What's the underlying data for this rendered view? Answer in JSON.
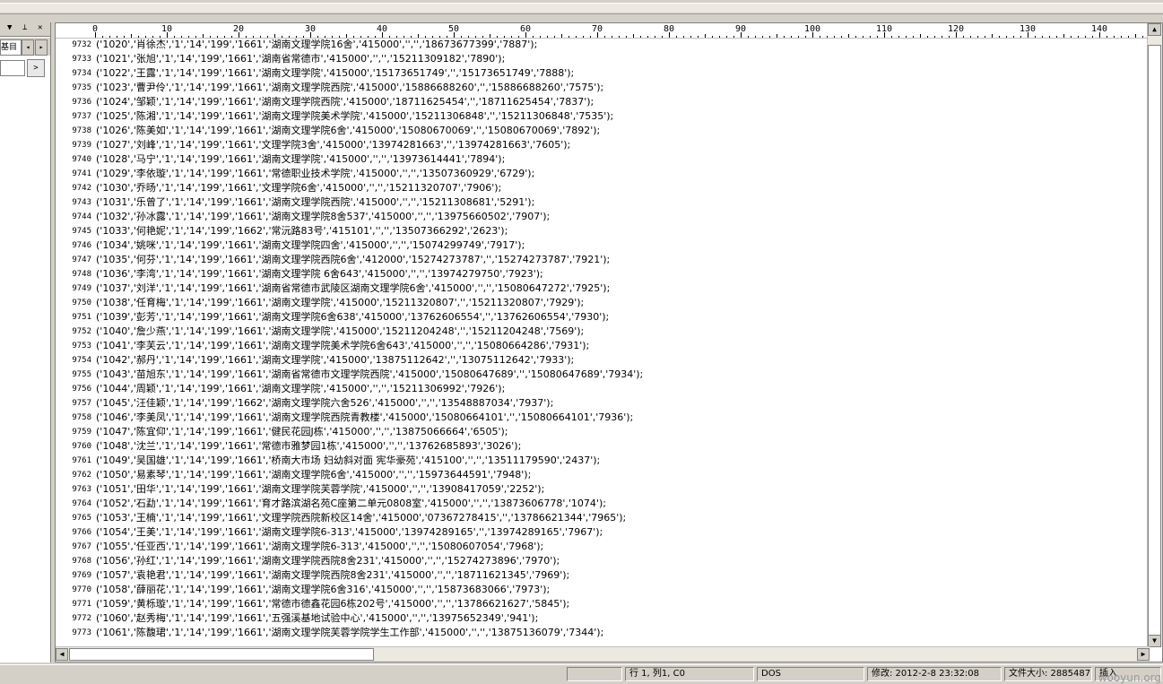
{
  "panel": {
    "tab_label": "基目录",
    "prev_label": "◂",
    "next_label": "▸",
    "go_label": ">"
  },
  "ruler": [
    "0",
    "10",
    "20",
    "30",
    "40",
    "50",
    "60",
    "70",
    "80",
    "90",
    "100",
    "110",
    "120",
    "130",
    "140"
  ],
  "lines": [
    {
      "n": "9732",
      "t": "('1020','肖徐杰','1','14','199','1661','湖南文理学院16舍','415000','','','18673677399','7887');"
    },
    {
      "n": "9733",
      "t": "('1021','张旭','1','14','199','1661','湖南省常德市','415000','','','15211309182','7890');"
    },
    {
      "n": "9734",
      "t": "('1022','王露','1','14','199','1661','湖南文理学院','415000','15173651749','','15173651749','7888');"
    },
    {
      "n": "9735",
      "t": "('1023','曹尹伶','1','14','199','1661','湖南文理学院西院','415000','15886688260','','15886688260','7575');"
    },
    {
      "n": "9736",
      "t": "('1024','邹颖','1','14','199','1661','湖南文理学院西院','415000','18711625454','','18711625454','7837');"
    },
    {
      "n": "9737",
      "t": "('1025','陈湘','1','14','199','1661','湖南文理学院美术学院','415000','15211306848','','15211306848','7535');"
    },
    {
      "n": "9738",
      "t": "('1026','陈美如','1','14','199','1661','湖南文理学院6舍','415000','15080670069','','15080670069','7892');"
    },
    {
      "n": "9739",
      "t": "('1027','刘峰','1','14','199','1661','文理学院3舍','415000','13974281663','','13974281663','7605');"
    },
    {
      "n": "9740",
      "t": "('1028','马宁','1','14','199','1661','湖南文理学院','415000','','','13973614441','7894');"
    },
    {
      "n": "9741",
      "t": "('1029','李依璇','1','14','199','1661','常德职业技术学院','415000','','','13507360929','6729');"
    },
    {
      "n": "9742",
      "t": "('1030','乔旸','1','14','199','1661','文理学院6舍','415000','','','15211320707','7906');"
    },
    {
      "n": "9743",
      "t": "('1031','乐曾了','1','14','199','1661','湖南文理学院西院','415000','','','15211308681','5291');"
    },
    {
      "n": "9744",
      "t": "('1032','孙冰露','1','14','199','1661','湖南文理学院8舍537','415000','','','13975660502','7907');"
    },
    {
      "n": "9745",
      "t": "('1033','何艳妮','1','14','199','1662','常沅路83号','415101','','','13507366292','2623');"
    },
    {
      "n": "9746",
      "t": "('1034','姚咪','1','14','199','1661','湖南文理学院四舍','415000','','','15074299749','7917');"
    },
    {
      "n": "9747",
      "t": "('1035','何芬','1','14','199','1661','湖南文理学院西院6舍','412000','15274273787','','15274273787','7921');"
    },
    {
      "n": "9748",
      "t": "('1036','李湾','1','14','199','1661','湖南文理学院 6舍643','415000','','','13974279750','7923');"
    },
    {
      "n": "9749",
      "t": "('1037','刘洋','1','14','199','1661','湖南省常德市武陵区湖南文理学院6舍','415000','','','15080647272','7925');"
    },
    {
      "n": "9750",
      "t": "('1038','任育梅','1','14','199','1661','湖南文理学院','415000','15211320807','','15211320807','7929');"
    },
    {
      "n": "9751",
      "t": "('1039','彭芳','1','14','199','1661','湖南文理学院6舍638','415000','13762606554','','13762606554','7930');"
    },
    {
      "n": "9752",
      "t": "('1040','詹少燕','1','14','199','1661','湖南文理学院','415000','15211204248','','15211204248','7569');"
    },
    {
      "n": "9753",
      "t": "('1041','李芙云','1','14','199','1661','湖南文理学院美术学院6舍643','415000','','','15080664286','7931');"
    },
    {
      "n": "9754",
      "t": "('1042','郝丹','1','14','199','1661','湖南文理学院','415000','13875112642','','13075112642','7933');"
    },
    {
      "n": "9755",
      "t": "('1043','苗旭东','1','14','199','1661','湖南省常德市文理学院西院','415000','15080647689','','15080647689','7934');"
    },
    {
      "n": "9756",
      "t": "('1044','周颖','1','14','199','1661','湖南文理学院','415000','','','15211306992','7926');"
    },
    {
      "n": "9757",
      "t": "('1045','汪佳颖','1','14','199','1662','湖南文理学院六舍526','415000','','','13548887034','7937');"
    },
    {
      "n": "9758",
      "t": "('1046','李美凤','1','14','199','1661','湖南文理学院西院青教楼','415000','15080664101','','15080664101','7936');"
    },
    {
      "n": "9759",
      "t": "('1047','陈宜仰','1','14','199','1661','健民花园J栋','415000','','','13875066664','6505');"
    },
    {
      "n": "9760",
      "t": "('1048','沈兰','1','14','199','1661','常德市雅梦园1栋','415000','','','13762685893','3026');"
    },
    {
      "n": "9761",
      "t": "('1049','吴国雄','1','14','199','1661','桥南大市场 妇幼斜对面 宪华豪苑','415100','','','13511179590','2437');"
    },
    {
      "n": "9762",
      "t": "('1050','易素琴','1','14','199','1661','湖南文理学院6舍','415000','','','15973644591','7948');"
    },
    {
      "n": "9763",
      "t": "('1051','田华','1','14','199','1661','湖南文理学院芙蓉学院','415000','','','13908417059','2252');"
    },
    {
      "n": "9764",
      "t": "('1052','石勐','1','14','199','1661','育才路滨湖名苑C座第二单元0808室','415000','','','13873606778','1074');"
    },
    {
      "n": "9765",
      "t": "('1053','王楠','1','14','199','1661','文理学院西院新校区14舍','415000','07367278415','','13786621344','7965');"
    },
    {
      "n": "9766",
      "t": "('1054','王美','1','14','199','1661','湖南文理学院6-313','415000','13974289165','','13974289165','7967');"
    },
    {
      "n": "9767",
      "t": "('1055','任亚西','1','14','199','1661','湖南文理学院6-313','415000','','','15080607054','7968');"
    },
    {
      "n": "9768",
      "t": "('1056','孙红','1','14','199','1661','湖南文理学院西院8舍231','415000','','','15274273896','7970');"
    },
    {
      "n": "9769",
      "t": "('1057','袁艳君','1','14','199','1661','湖南文理学院西院8舍231','415000','','','18711621345','7969');"
    },
    {
      "n": "9770",
      "t": "('1058','薛丽花','1','14','199','1661','湖南文理学院6舍316','415000','','','15873683066','7973');"
    },
    {
      "n": "9771",
      "t": "('1059','黄栎璇','1','14','199','1661','常德市德鑫花园6栋202号','415000','','','13786621627','5845');"
    },
    {
      "n": "9772",
      "t": "('1060','赵秀梅','1','14','199','1661','五强溪基地试验中心','415000','','','13975652349','941');"
    },
    {
      "n": "9773",
      "t": "('1061','陈馥珺','1','14','199','1661','湖南文理学院芙蓉学院学生工作部','415000','','','13875136079','7344');"
    }
  ],
  "status": {
    "position": "行 1, 列1, C0",
    "line_format": "DOS",
    "modified": "修改: 2012-2-8 23:32:08",
    "file_size": "文件大小: 2885487",
    "mode": "插入"
  },
  "watermark": "wooyun.org"
}
